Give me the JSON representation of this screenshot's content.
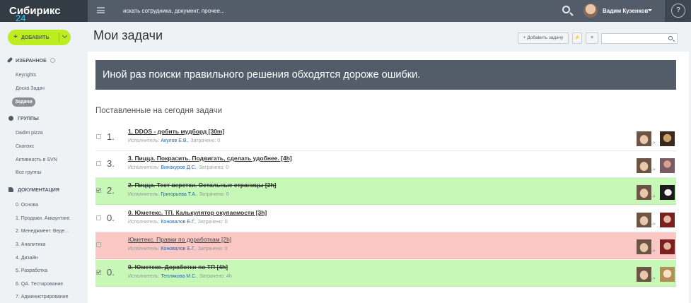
{
  "app": {
    "brand": "Сибирикс",
    "brand_version": "24",
    "search_placeholder": "искать сотрудника, документ, прочее...",
    "user_name": "Вадим Кузенков",
    "help_label": "?"
  },
  "sidebar": {
    "add_label": "ДОБАВИТЬ",
    "sections": {
      "favorites": "ИЗБРАННОЕ",
      "groups": "ГРУППЫ",
      "docs": "ДОКУМЕНТАЦИЯ"
    },
    "favorites": [
      "Keyrights",
      "Доска Задач",
      "Задачи"
    ],
    "groups": [
      "Dadim pizza",
      "Сканэкс",
      "Активность в SVN",
      "Все группы"
    ],
    "docs": [
      "0. Основа",
      "1. Продажи. Аккаунтинг.",
      "2. Менеджмент. Веде...",
      "3. Аналитика",
      "4. Дизайн",
      "5. Разработка",
      "6. QA. Тестирование",
      "7. Администрирование"
    ]
  },
  "main": {
    "title": "Мои задачи",
    "add_task_label": "Добавить задачу",
    "quote": "Иной раз поиски правильного решения обходятся дороже ошибки.",
    "section_title": "Поставленные на сегодня задачи",
    "executor_label": "Исполнитель:",
    "spent_label": "Затрачено:",
    "arrow": "->"
  },
  "tasks": [
    {
      "num": "1.",
      "name": "1. DDOS - добить мудборд [30m]",
      "executor": "Акулов Е.В.",
      "spent": "0",
      "status": "open",
      "checked": false
    },
    {
      "num": "3.",
      "name": "3. Пицца. Покрасить. Подвигать, сделать удобнее. [4h]",
      "executor": "Винокуров Д.С.",
      "spent": "0",
      "status": "open",
      "checked": false
    },
    {
      "num": "2.",
      "name": "2. Пицца. Тест верстки. Остальные страницы [2h]",
      "executor": "Григорьева Т.А.",
      "spent": "0",
      "status": "done",
      "checked": true
    },
    {
      "num": "0.",
      "name": "0. Юметекс. ТП. Калькулятор окупаемости [3h]",
      "executor": "Коновалов Е.Г.",
      "spent": "0",
      "status": "open",
      "checked": false
    },
    {
      "num": "",
      "name": "Юметекс. Правки по доработкам [2h]",
      "executor": "Коновалов Е.Г.",
      "spent": "0",
      "status": "overdue",
      "checked": false
    },
    {
      "num": "0.",
      "name": "0. Юметекс. Доработки по ТП [4h]",
      "executor": "Теплякова М.С.",
      "spent": "4h",
      "status": "done",
      "checked": true
    }
  ],
  "colors": {
    "topbar": "#535c69",
    "brand_bg": "#333b45",
    "accent_green": "#bbed21",
    "done_row": "#c7f8b8",
    "overdue_row": "#fbc8c6",
    "link": "#2067b0"
  }
}
